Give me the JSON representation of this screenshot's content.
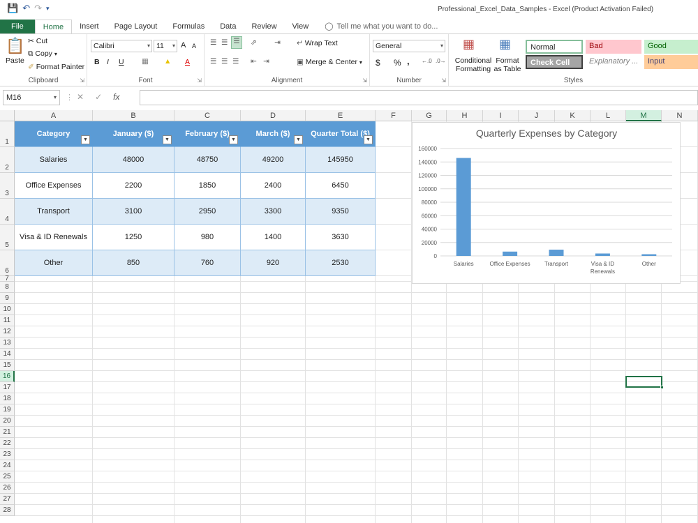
{
  "window": {
    "title": "Professional_Excel_Data_Samples - Excel (Product Activation Failed)"
  },
  "tabs": [
    {
      "label": "File"
    },
    {
      "label": "Home"
    },
    {
      "label": "Insert"
    },
    {
      "label": "Page Layout"
    },
    {
      "label": "Formulas"
    },
    {
      "label": "Data"
    },
    {
      "label": "Review"
    },
    {
      "label": "View"
    }
  ],
  "tell_me": "Tell me what you want to do...",
  "ribbon": {
    "clipboard": {
      "paste": "Paste",
      "cut": "Cut",
      "copy": "Copy",
      "format_painter": "Format Painter",
      "group": "Clipboard"
    },
    "font": {
      "name": "Calibri",
      "size": "11",
      "group": "Font",
      "bold": "B",
      "italic": "I",
      "underline": "U",
      "grow": "A",
      "shrink": "A",
      "font_color": "A"
    },
    "alignment": {
      "wrap_text": "Wrap Text",
      "merge_center": "Merge & Center",
      "group": "Alignment"
    },
    "number": {
      "format": "General",
      "currency": "$",
      "percent": "%",
      "comma": ",",
      "group": "Number"
    },
    "styles": {
      "conditional_formatting": "Conditional Formatting",
      "format_as_table": "Format as Table",
      "normal": "Normal",
      "bad": "Bad",
      "good": "Good",
      "check_cell": "Check Cell",
      "explanatory": "Explanatory ...",
      "input": "Input",
      "group": "Styles"
    }
  },
  "formula_bar": {
    "name_box": "M16",
    "fx": "fx",
    "cancel": "✕",
    "enter": "✓"
  },
  "columns": [
    "A",
    "B",
    "C",
    "D",
    "E",
    "F",
    "G",
    "H",
    "I",
    "J",
    "K",
    "L",
    "M",
    "N"
  ],
  "rows": [
    "1",
    "2",
    "3",
    "4",
    "5",
    "6",
    "7",
    "8",
    "9",
    "10",
    "11",
    "12",
    "13",
    "14",
    "15",
    "16",
    "17",
    "18",
    "19",
    "20",
    "21",
    "22",
    "23",
    "24",
    "25",
    "26",
    "27",
    "28"
  ],
  "table": {
    "headers": [
      "Category",
      "January ($)",
      "February ($)",
      "March ($)",
      "Quarter Total ($)"
    ],
    "rows": [
      [
        "Salaries",
        "48000",
        "48750",
        "49200",
        "145950"
      ],
      [
        "Office Expenses",
        "2200",
        "1850",
        "2400",
        "6450"
      ],
      [
        "Transport",
        "3100",
        "2950",
        "3300",
        "9350"
      ],
      [
        "Visa & ID Renewals",
        "1250",
        "980",
        "1400",
        "3630"
      ],
      [
        "Other",
        "850",
        "760",
        "920",
        "2530"
      ]
    ]
  },
  "chart_data": {
    "type": "bar",
    "title": "Quarterly Expenses by Category",
    "categories": [
      "Salaries",
      "Office Expenses",
      "Transport",
      "Visa & ID Renewals",
      "Other"
    ],
    "category_labels": [
      [
        "Salaries"
      ],
      [
        "Office Expenses"
      ],
      [
        "Transport"
      ],
      [
        "Visa & ID",
        "Renewals"
      ],
      [
        "Other"
      ]
    ],
    "values": [
      145950,
      6450,
      9350,
      3630,
      2530
    ],
    "ylim": [
      0,
      160000
    ],
    "yticks": [
      "0",
      "20000",
      "40000",
      "60000",
      "80000",
      "100000",
      "120000",
      "140000",
      "160000"
    ],
    "grid": true,
    "bar_color": "#5b9bd5"
  },
  "colors": {
    "accent": "#217346",
    "table_header": "#5b9bd5",
    "table_band": "#ddebf7"
  }
}
